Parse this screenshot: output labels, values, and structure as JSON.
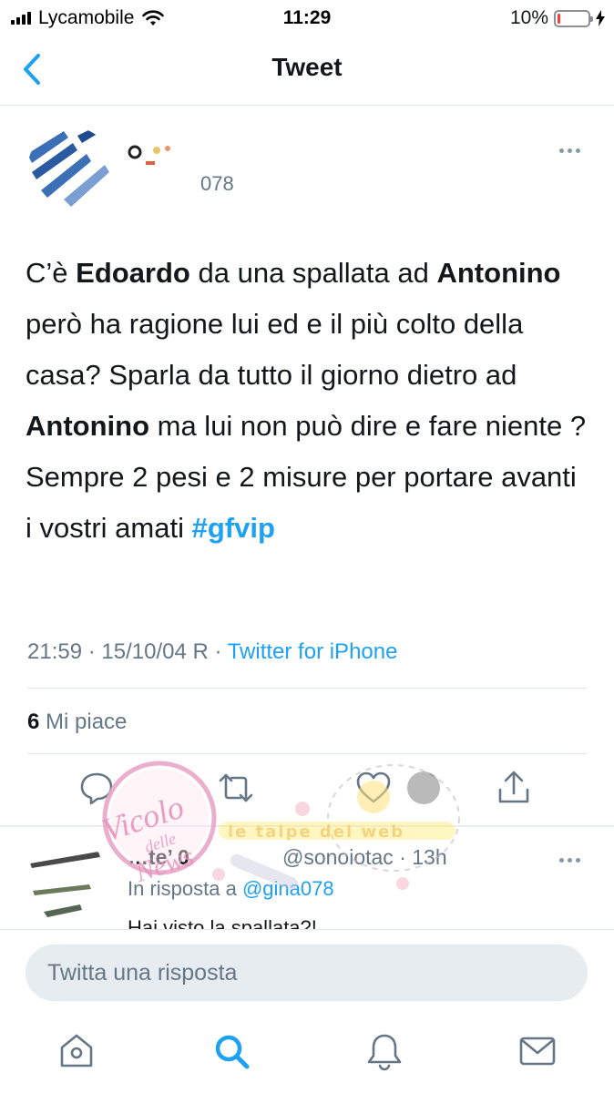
{
  "status_bar": {
    "carrier": "Lycamobile",
    "time": "11:29",
    "battery_percent": "10%",
    "battery_level": 0.1,
    "icons": [
      "signal-bars-icon",
      "wifi-icon",
      "battery-icon",
      "charging-bolt-icon"
    ]
  },
  "nav": {
    "title": "Tweet",
    "back_icon": "chevron-left-icon"
  },
  "tweet": {
    "handle_partial": "078",
    "text": {
      "p1": "C’è ",
      "b1": "Edoardo",
      "p2": " da una spallata ad ",
      "b2": "Antonino",
      "p3": " però ha ragione lui ed e il più colto della casa? Sparla da tutto il giorno dietro ad ",
      "b3": "Antonino",
      "p4": " ma lui non può dire e fare niente ? Sempre 2 pesi e 2 misure per portare avanti i vostri amati  ",
      "hashtag": "#gfvip"
    },
    "timestamp": "21:59 · 15/10/04 R · ",
    "source": "Twitter for iPhone",
    "likes_count": "6",
    "likes_label": " Mi piace",
    "actions": [
      "reply-icon",
      "retweet-icon",
      "like-icon",
      "share-icon"
    ]
  },
  "reply": {
    "name_partial": "…te’ 0",
    "handle": "@sonoiotac · 13h",
    "reply_to_prefix": "In risposta a ",
    "reply_to_mention": "@gina078",
    "text": "Hai visto la spallata?!"
  },
  "compose": {
    "placeholder": "Twitta una risposta"
  },
  "tab_bar": {
    "items": [
      "home-icon",
      "search-icon",
      "notifications-icon",
      "messages-icon"
    ],
    "active": "search-icon"
  },
  "watermarks": {
    "stamp_text": "Vicolo delle News",
    "banner_text": "le talpe del web"
  },
  "colors": {
    "accent": "#1da1f2",
    "text": "#14171a",
    "secondary": "#657786",
    "battery_low": "#ff3b30"
  }
}
